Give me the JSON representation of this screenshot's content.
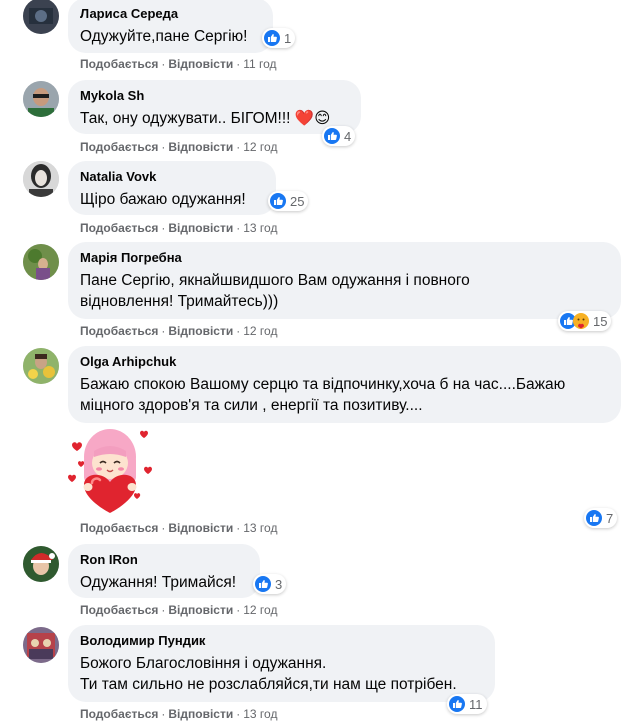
{
  "comments": [
    {
      "author": "Лариса Середа",
      "text": "Одужуйте,пане Сергію!",
      "like_label": "Подобається",
      "reply_label": "Відповісти",
      "time": "11 год",
      "reaction_count": "1",
      "reaction_icons": [
        "like-icon"
      ]
    },
    {
      "author": "Mykola Sh",
      "text": "Так, ону одужувати.. БІГОМ!!! ❤️😊",
      "like_label": "Подобається",
      "reply_label": "Відповісти",
      "time": "12 год",
      "reaction_count": "4",
      "reaction_icons": [
        "like-icon"
      ]
    },
    {
      "author": "Natalia Vovk",
      "text": "Щіро бажаю одужання!",
      "like_label": "Подобається",
      "reply_label": "Відповісти",
      "time": "13 год",
      "reaction_count": "25",
      "reaction_icons": [
        "like-icon"
      ]
    },
    {
      "author": "Марія Погребна",
      "text": "Пане Сергію, якнайшвидшого Вам одужання і повного\nвідновлення! Тримайтесь)))",
      "like_label": "Подобається",
      "reply_label": "Відповісти",
      "time": "12 год",
      "reaction_count": "15",
      "reaction_icons": [
        "like-icon",
        "care-icon"
      ]
    },
    {
      "author": "Olga Arhipchuk",
      "text": "Бажаю спокою Вашому серцю та відпочинку,хоча б на час....Бажаю\nміцного здоров'я та сили , енергії та позитиву....",
      "like_label": "Подобається",
      "reply_label": "Відповісти",
      "time": "13 год",
      "reaction_count": "7",
      "reaction_icons": [
        "like-icon"
      ],
      "sticker": "heart-hug-sticker"
    },
    {
      "author": "Ron IRon",
      "text": "Одужання! Тримайся!",
      "like_label": "Подобається",
      "reply_label": "Відповісти",
      "time": "12 год",
      "reaction_count": "3",
      "reaction_icons": [
        "like-icon"
      ]
    },
    {
      "author": "Володимир Пундик",
      "text": "Божого Благословіння і одужання.\nТи там сильно не розслабляйся,ти нам ще потрібен.",
      "like_label": "Подобається",
      "reply_label": "Відповісти",
      "time": "13 год",
      "reaction_count": "11",
      "reaction_icons": [
        "like-icon"
      ]
    }
  ],
  "colors": {
    "bubble": "#f0f2f5",
    "meta_text": "#65676b",
    "like_blue": "#1877f2",
    "heart_red": "#e0242f",
    "sticker_pink": "#f7a8c6"
  }
}
